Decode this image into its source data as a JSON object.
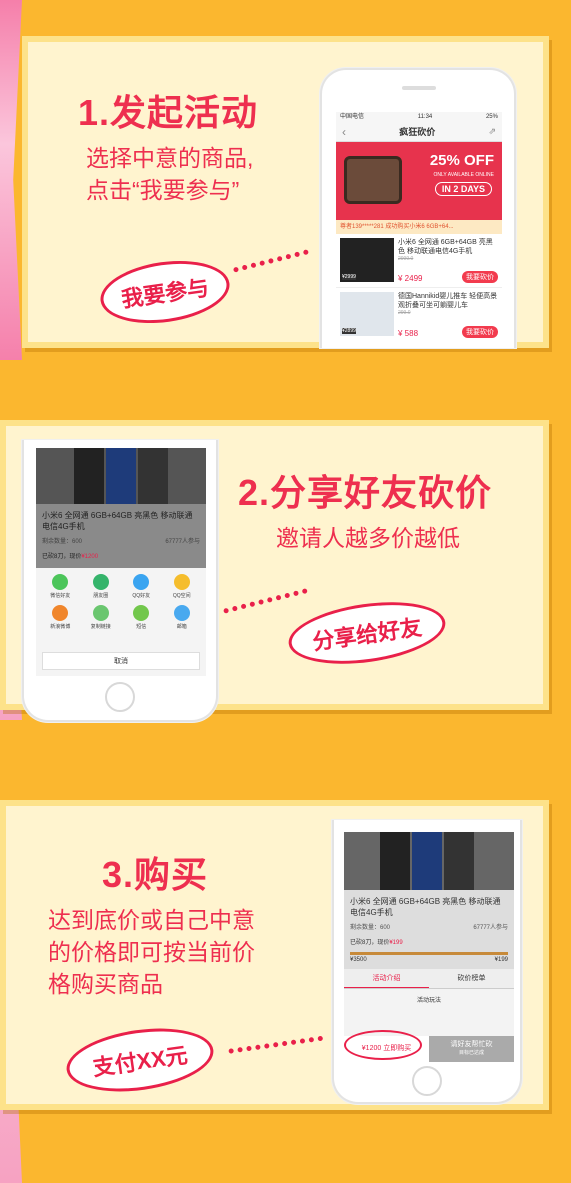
{
  "step1": {
    "title": "1.发起活动",
    "desc_line1": "选择中意的商品,",
    "desc_line2": "点击“我要参与”",
    "bubble": "我要参与",
    "phone": {
      "carrier": "中国电信",
      "time": "11:34",
      "battery": "25%",
      "nav_title": "疯狂砍价",
      "banner_big": "25% OFF",
      "banner_small": "ONLY AVAILABLE ONLINE",
      "banner_days": "IN 2 DAYS",
      "marquee": "尊者139*****281 成功购买小米6 6GB+64...",
      "products": [
        {
          "name": "小米6 全网通 6GB+64GB 亮黑色 移动联通电信4G手机",
          "orig": "2999.0",
          "price": "¥ 2499",
          "tag": "¥2999",
          "stock": "剩余数量：600",
          "btn": "我要砍价"
        },
        {
          "name": "德国Hannikid婴儿推车 轻便高景观折叠可坐可躺婴儿车",
          "orig": "299.0",
          "price": "¥ 588",
          "tag": "¥2899",
          "stock": "剩余数量：600",
          "btn": "我要砍价"
        }
      ]
    }
  },
  "step2": {
    "title": "2.分享好友砍价",
    "desc": "邀请人越多价越低",
    "bubble": "分享给好友",
    "phone": {
      "product": "小米6 全网通 6GB+64GB 亮黑色 移动联通电信4G手机",
      "stock": "剩余数量：600",
      "joined": "67777人参与",
      "bargain": "已砍8刀，现价",
      "bargain_price": "¥1200",
      "share_items": [
        {
          "label": "微信好友",
          "color": "#4cc55a"
        },
        {
          "label": "朋友圈",
          "color": "#35b46b"
        },
        {
          "label": "QQ好友",
          "color": "#3aa4f0"
        },
        {
          "label": "QQ空间",
          "color": "#f5bd2c"
        },
        {
          "label": "新浪微博",
          "color": "#f0862c"
        },
        {
          "label": "复制链接",
          "color": "#6ac66f"
        },
        {
          "label": "短信",
          "color": "#72c74c"
        },
        {
          "label": "邮箱",
          "color": "#49a9ef"
        }
      ],
      "cancel": "取消"
    }
  },
  "step3": {
    "title": "3.购买",
    "desc_line1": "达到底价或自己中意",
    "desc_line2": "的价格即可按当前价",
    "desc_line3": "格购买商品",
    "bubble": "支付XX元",
    "phone": {
      "product": "小米6 全网通 6GB+64GB 亮黑色 移动联通电信4G手机",
      "stock": "剩余数量：600",
      "joined": "67777人参与",
      "bargain": "已砍8刀，现价",
      "bargain_price": "¥199",
      "range_low": "¥3500",
      "range_high": "¥199",
      "tab1": "活动介绍",
      "tab2": "砍价榜单",
      "rules": "活动玩法",
      "buy_btn": "¥1200 立即购买",
      "help_btn": "请好友帮忙砍",
      "help_sub": "目标已达成"
    }
  }
}
